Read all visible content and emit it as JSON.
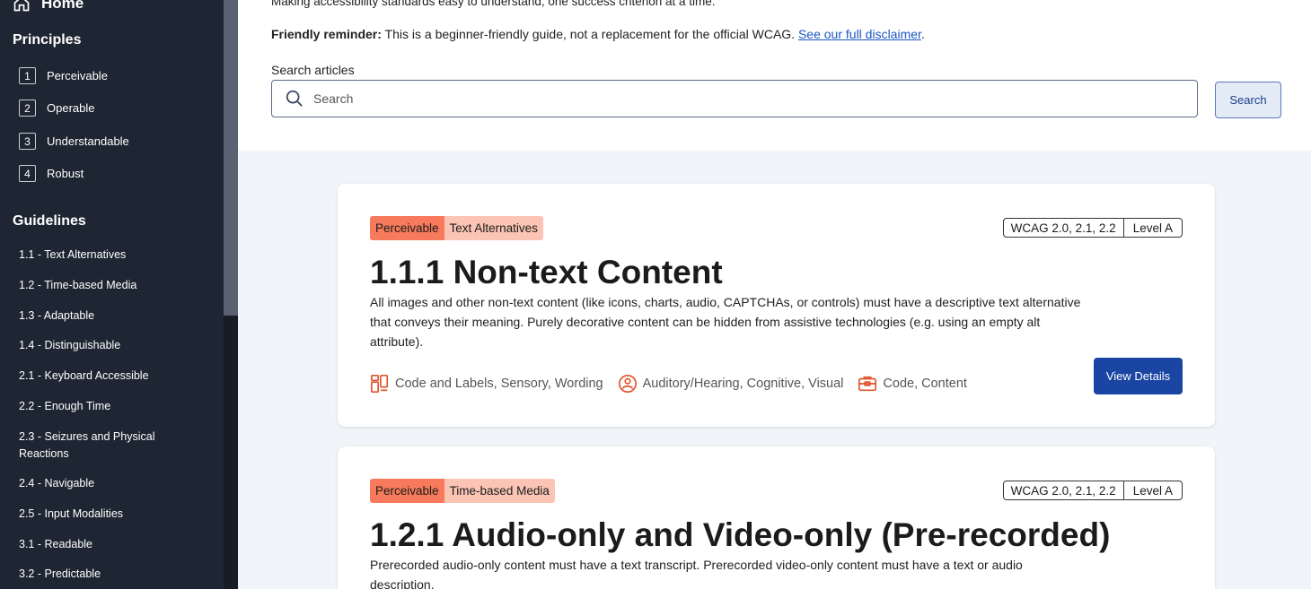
{
  "sidebar": {
    "home_label": "Home",
    "principles_heading": "Principles",
    "principles": [
      {
        "num": "1",
        "label": "Perceivable"
      },
      {
        "num": "2",
        "label": "Operable"
      },
      {
        "num": "3",
        "label": "Understandable"
      },
      {
        "num": "4",
        "label": "Robust"
      }
    ],
    "guidelines_heading": "Guidelines",
    "guidelines": [
      "1.1 - Text Alternatives",
      "1.2 - Time-based Media",
      "1.3 - Adaptable",
      "1.4 - Distinguishable",
      "2.1 - Keyboard Accessible",
      "2.2 - Enough Time",
      "2.3 - Seizures and Physical Reactions",
      "2.4 - Navigable",
      "2.5 - Input Modalities",
      "3.1 - Readable",
      "3.2 - Predictable"
    ]
  },
  "header": {
    "tagline": "Making accessibility standards easy to understand, one success criterion at a time.",
    "reminder_label": "Friendly reminder:",
    "reminder_text": " This is a beginner-friendly guide, not a replacement for the official WCAG. ",
    "disclaimer_link": "See our full disclaimer",
    "reminder_end": "."
  },
  "search": {
    "label": "Search articles",
    "placeholder": "Search",
    "button_label": "Search"
  },
  "cards": [
    {
      "principle": "Perceivable",
      "guideline": "Text Alternatives",
      "versions": "WCAG 2.0, 2.1, 2.2",
      "level": "Level A",
      "title": "1.1.1 Non-text Content",
      "description": "All images and other non-text content (like icons, charts, audio, CAPTCHAs, or controls) must have a descriptive text alternative that conveys their meaning. Purely decorative content can be hidden from assistive technologies (e.g. using an empty alt attribute).",
      "categories": "Code and Labels, Sensory, Wording",
      "disabilities": "Auditory/Hearing, Cognitive, Visual",
      "roles": "Code, Content",
      "button_label": "View Details"
    },
    {
      "principle": "Perceivable",
      "guideline": "Time-based Media",
      "versions": "WCAG 2.0, 2.1, 2.2",
      "level": "Level A",
      "title": "1.2.1 Audio-only and Video-only (Pre-recorded)",
      "description": "Prerecorded audio-only content must have a text transcript. Prerecorded video-only content must have a text or audio description."
    }
  ],
  "colors": {
    "sidebar_bg": "#1e2633",
    "principle_tag": "#f67a5b",
    "guideline_tag": "#fbc4b4",
    "primary_button": "#1a45a3",
    "link": "#1a56c4"
  }
}
